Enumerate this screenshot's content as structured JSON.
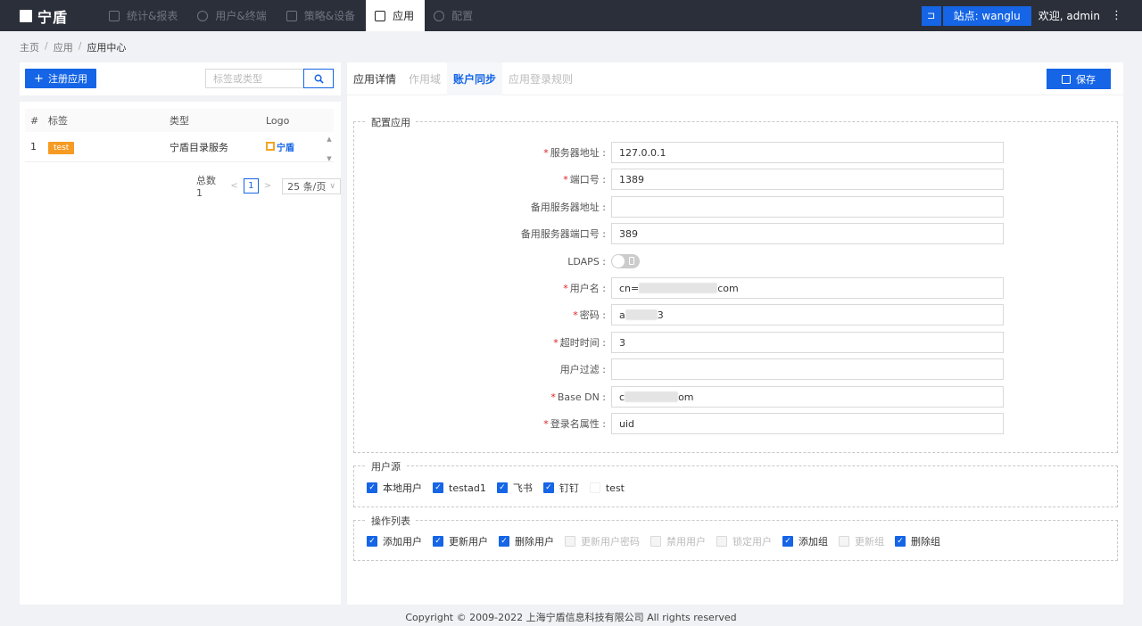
{
  "brand": {
    "name": "宁盾"
  },
  "nav": [
    {
      "label": "统计&报表",
      "icon": "chart-icon",
      "active": false
    },
    {
      "label": "用户&终端",
      "icon": "user-icon",
      "active": false
    },
    {
      "label": "策略&设备",
      "icon": "device-icon",
      "active": false
    },
    {
      "label": "应用",
      "icon": "grid-icon",
      "active": true
    },
    {
      "label": "配置",
      "icon": "gear-icon",
      "active": false
    }
  ],
  "topright": {
    "site": "站点: wanglu",
    "welcome": "欢迎, admin",
    "more": "⋮"
  },
  "breadcrumb": {
    "home": "主页",
    "app": "应用",
    "current": "应用中心"
  },
  "left": {
    "register_label": "注册应用",
    "search_placeholder": "标签或类型",
    "columns": [
      "#",
      "标签",
      "类型",
      "Logo"
    ],
    "rows": [
      {
        "index": "1",
        "tag": "test",
        "type": "宁盾目录服务",
        "logo": "宁盾"
      }
    ],
    "pager": {
      "total": "总数 1",
      "page": "1",
      "size": "25 条/页"
    }
  },
  "tabs": [
    "应用详情",
    "作用域",
    "账户同步",
    "应用登录规则"
  ],
  "save_label": "保存",
  "config": {
    "legend": "配置应用",
    "fields": [
      {
        "label": "服务器地址",
        "required": "*",
        "value": "127.0.0.1"
      },
      {
        "label": "端口号",
        "required": "*",
        "value": "1389"
      },
      {
        "label": "备用服务器地址",
        "required": "",
        "value": ""
      },
      {
        "label": "备用服务器端口号",
        "required": "",
        "value": "389"
      },
      {
        "label": "LDAPS",
        "required": "",
        "value": ""
      },
      {
        "label": "用户名",
        "required": "*",
        "value_prefix": "cn=",
        "value_suffix": "com"
      },
      {
        "label": "密码",
        "required": "*",
        "value_prefix": "a",
        "value_suffix": "3"
      },
      {
        "label": "超时时间",
        "required": "*",
        "value": "3"
      },
      {
        "label": "用户过滤",
        "required": "",
        "value": ""
      },
      {
        "label": "Base DN",
        "required": "*",
        "value_prefix": "c",
        "value_suffix": "om"
      },
      {
        "label": "登录名属性",
        "required": "*",
        "value": "uid"
      }
    ],
    "colon": " :"
  },
  "sources": {
    "legend": "用户源",
    "items": [
      {
        "label": "本地用户",
        "checked": true
      },
      {
        "label": "testad1",
        "checked": true
      },
      {
        "label": "飞书",
        "checked": true
      },
      {
        "label": "钉钉",
        "checked": true
      },
      {
        "label": "test",
        "checked": false
      }
    ]
  },
  "operations": {
    "legend": "操作列表",
    "items": [
      {
        "label": "添加用户",
        "checked": true
      },
      {
        "label": "更新用户",
        "checked": true
      },
      {
        "label": "删除用户",
        "checked": true
      },
      {
        "label": "更新用户密码",
        "checked": false
      },
      {
        "label": "禁用用户",
        "checked": false
      },
      {
        "label": "锁定用户",
        "checked": false
      },
      {
        "label": "添加组",
        "checked": true
      },
      {
        "label": "更新组",
        "checked": false
      },
      {
        "label": "删除组",
        "checked": true
      }
    ]
  },
  "footer": "Copyright © 2009-2022 上海宁盾信息科技有限公司 All rights reserved"
}
